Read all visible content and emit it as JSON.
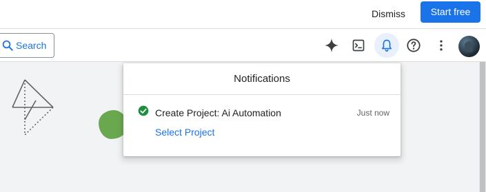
{
  "promo": {
    "dismiss_label": "Dismiss",
    "start_free_label": "Start free",
    "accent_color": "#1a73e8"
  },
  "toolbar": {
    "search_label": "Search",
    "icons": [
      "search-icon",
      "gemini-sparkle-icon",
      "terminal-icon",
      "bell-icon",
      "help-icon",
      "more-vert-icon"
    ]
  },
  "notifications": {
    "title": "Notifications",
    "items": [
      {
        "title": "Create Project: Ai Automation",
        "time": "Just now",
        "action": "Select Project",
        "status": "success",
        "status_color": "#1e8e3e"
      }
    ]
  }
}
